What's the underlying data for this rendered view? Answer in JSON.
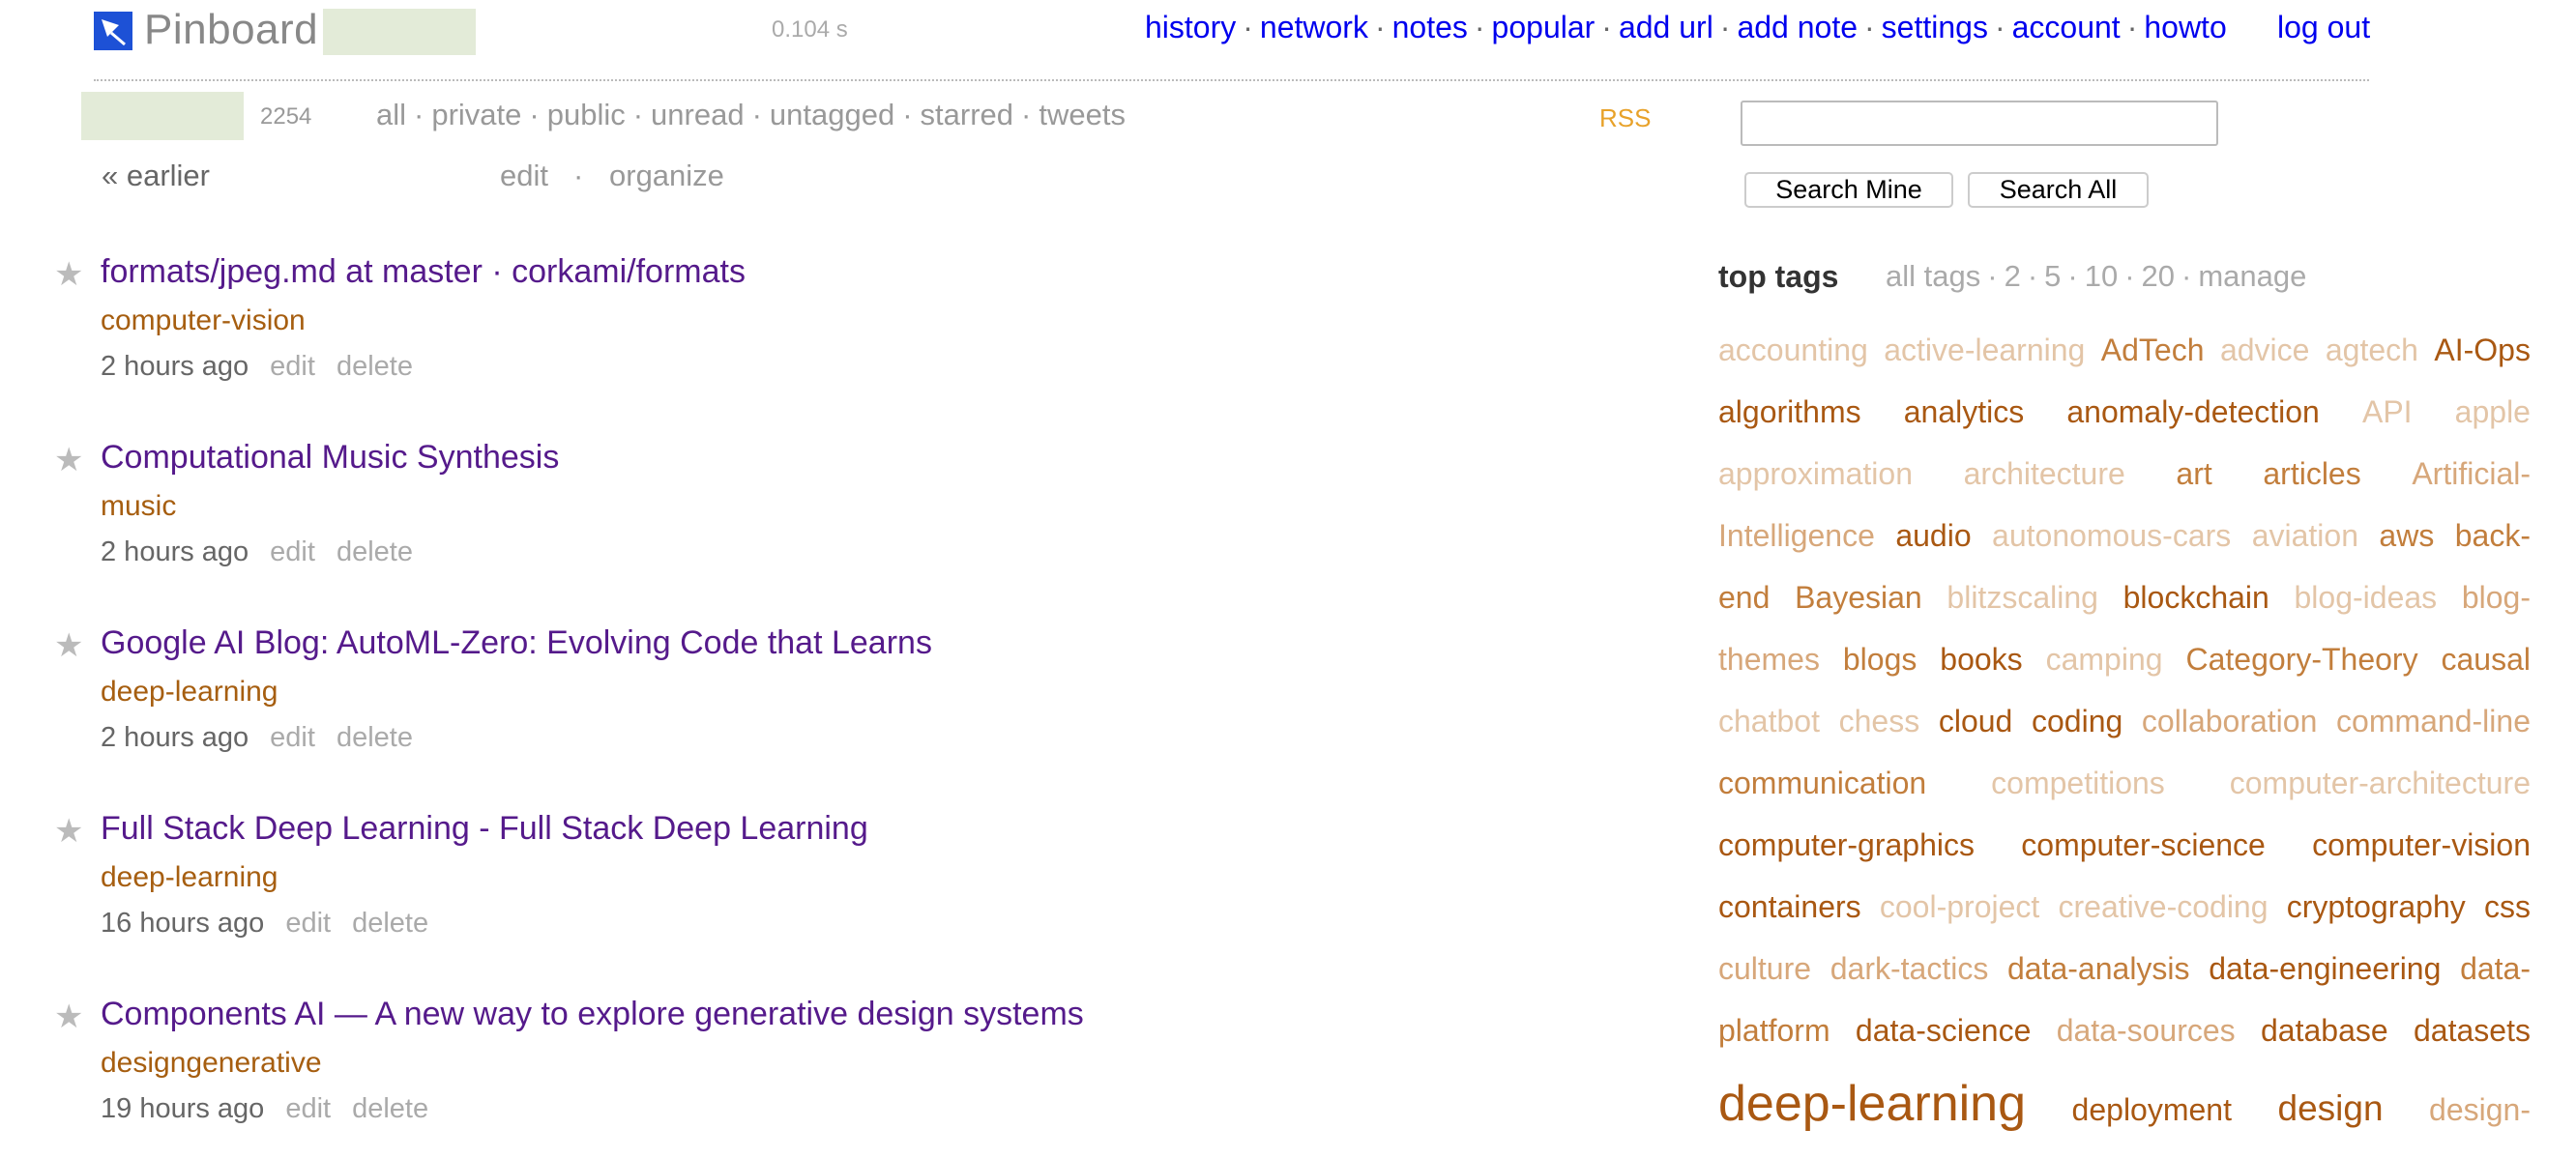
{
  "header": {
    "logo_text": "Pinboard",
    "timing": "0.104 s",
    "nav": [
      "history",
      "network",
      "notes",
      "popular",
      "add url",
      "add note",
      "settings",
      "account",
      "howto"
    ],
    "logout": "log out"
  },
  "subbar": {
    "count": "2254",
    "filters": [
      "all",
      "private",
      "public",
      "unread",
      "untagged",
      "starred",
      "tweets"
    ],
    "rss": "RSS",
    "earlier": "« earlier",
    "edit": "edit",
    "dot": "·",
    "organize": "organize"
  },
  "search": {
    "value": "",
    "mine_label": "Search Mine",
    "all_label": "Search All"
  },
  "bookmarks": [
    {
      "title": "formats/jpeg.md at master · corkami/formats",
      "tags": [
        "computer-vision"
      ],
      "time": "2 hours ago"
    },
    {
      "title": "Computational Music Synthesis",
      "tags": [
        "music"
      ],
      "time": "2 hours ago"
    },
    {
      "title": "Google AI Blog: AutoML-Zero: Evolving Code that Learns",
      "tags": [
        "deep-learning"
      ],
      "time": "2 hours ago"
    },
    {
      "title": "Full Stack Deep Learning - Full Stack Deep Learning",
      "tags": [
        "deep-learning"
      ],
      "time": "16 hours ago"
    },
    {
      "title": "Components AI — A new way to explore generative design systems",
      "tags": [
        "design",
        "generative"
      ],
      "time": "19 hours ago"
    }
  ],
  "bookmark_actions": {
    "edit": "edit",
    "delete": "delete"
  },
  "star_glyph": "★",
  "top_tags": {
    "heading": "top tags",
    "links": [
      "all tags",
      "2",
      "5",
      "10",
      "20",
      "manage"
    ],
    "lines": [
      [
        "accounting",
        "active-learning",
        "AdTech",
        "advice",
        "agtech",
        "AI-Ops"
      ],
      [
        "algorithms",
        "analytics",
        "anomaly-detection",
        "API",
        "apple"
      ],
      [
        "approximation",
        "architecture",
        "art",
        "articles",
        "Artificial-"
      ],
      [
        "Intelligence",
        "audio",
        "autonomous-cars",
        "aviation",
        "aws",
        "back-"
      ],
      [
        "end",
        "Bayesian",
        "blitzscaling",
        "blockchain",
        "blog-ideas",
        "blog-"
      ],
      [
        "themes",
        "blogs",
        "books",
        "camping",
        "Category-Theory",
        "causal"
      ],
      [
        "chatbot",
        "chess",
        "cloud",
        "coding",
        "collaboration",
        "command-line"
      ],
      [
        "communication",
        "competitions",
        "computer-architecture"
      ],
      [
        "computer-graphics",
        "computer-science",
        "computer-vision"
      ],
      [
        "containers",
        "cool-project",
        "creative-coding",
        "cryptography",
        "css"
      ],
      [
        "culture",
        "dark-tactics",
        "data-analysis",
        "data-engineering",
        "data-"
      ],
      [
        "platform",
        "data-science",
        "data-sources",
        "database",
        "datasets"
      ],
      [
        "deep-learning",
        "deployment",
        "design",
        "design-"
      ]
    ]
  },
  "colors": {
    "link": "#0000ee",
    "visited_title": "#551a8b",
    "tag": "#a65e10",
    "rss": "#e8a22a",
    "logo_blue": "#1d51d6"
  },
  "icons": {
    "logo": "pinboard-pin-icon",
    "star": "star-icon"
  }
}
